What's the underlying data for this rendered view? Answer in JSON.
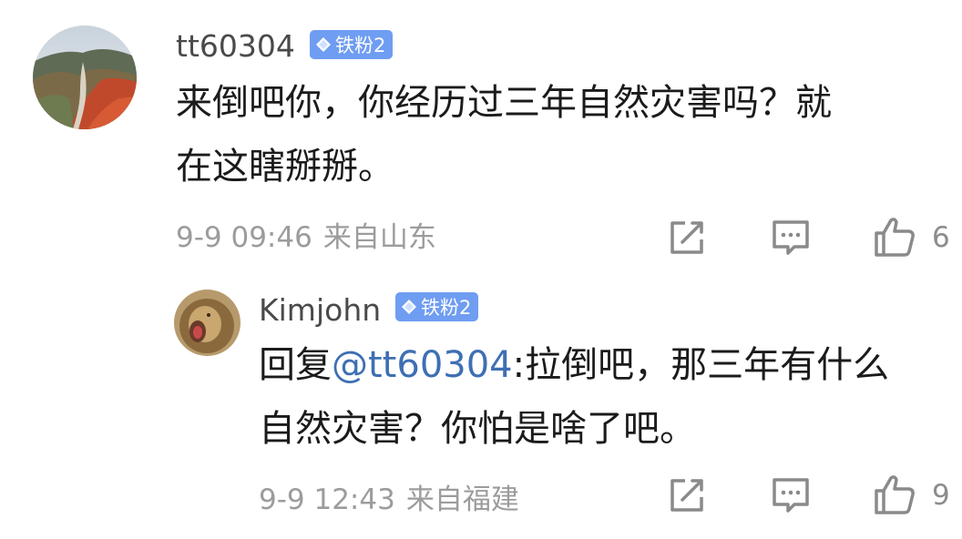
{
  "comments": [
    {
      "username": "tt60304",
      "badge": "铁粉2",
      "text_line1": "来倒吧你，你经历过三年自然灾害吗？就",
      "text_line2": "在这瞎掰掰。",
      "date": "9-9 09:46",
      "location": "来自山东",
      "likes": "6",
      "avatar_icon": "mountain-autumn-avatar"
    },
    {
      "username": "Kimjohn",
      "badge": "铁粉2",
      "reply_prefix": "回复",
      "mention": "@tt60304",
      "text_line1_rest": ":拉倒吧，那三年有什么",
      "text_line2": "自然灾害？你怕是啥了吧。",
      "date": "9-9 12:43",
      "location": "来自福建",
      "likes": "9",
      "avatar_icon": "lion-avatar"
    }
  ],
  "colors": {
    "badge_bg": "#6f9df2",
    "mention": "#3e6fb3",
    "meta": "#9c9c9c",
    "icon": "#8a8a8a"
  }
}
